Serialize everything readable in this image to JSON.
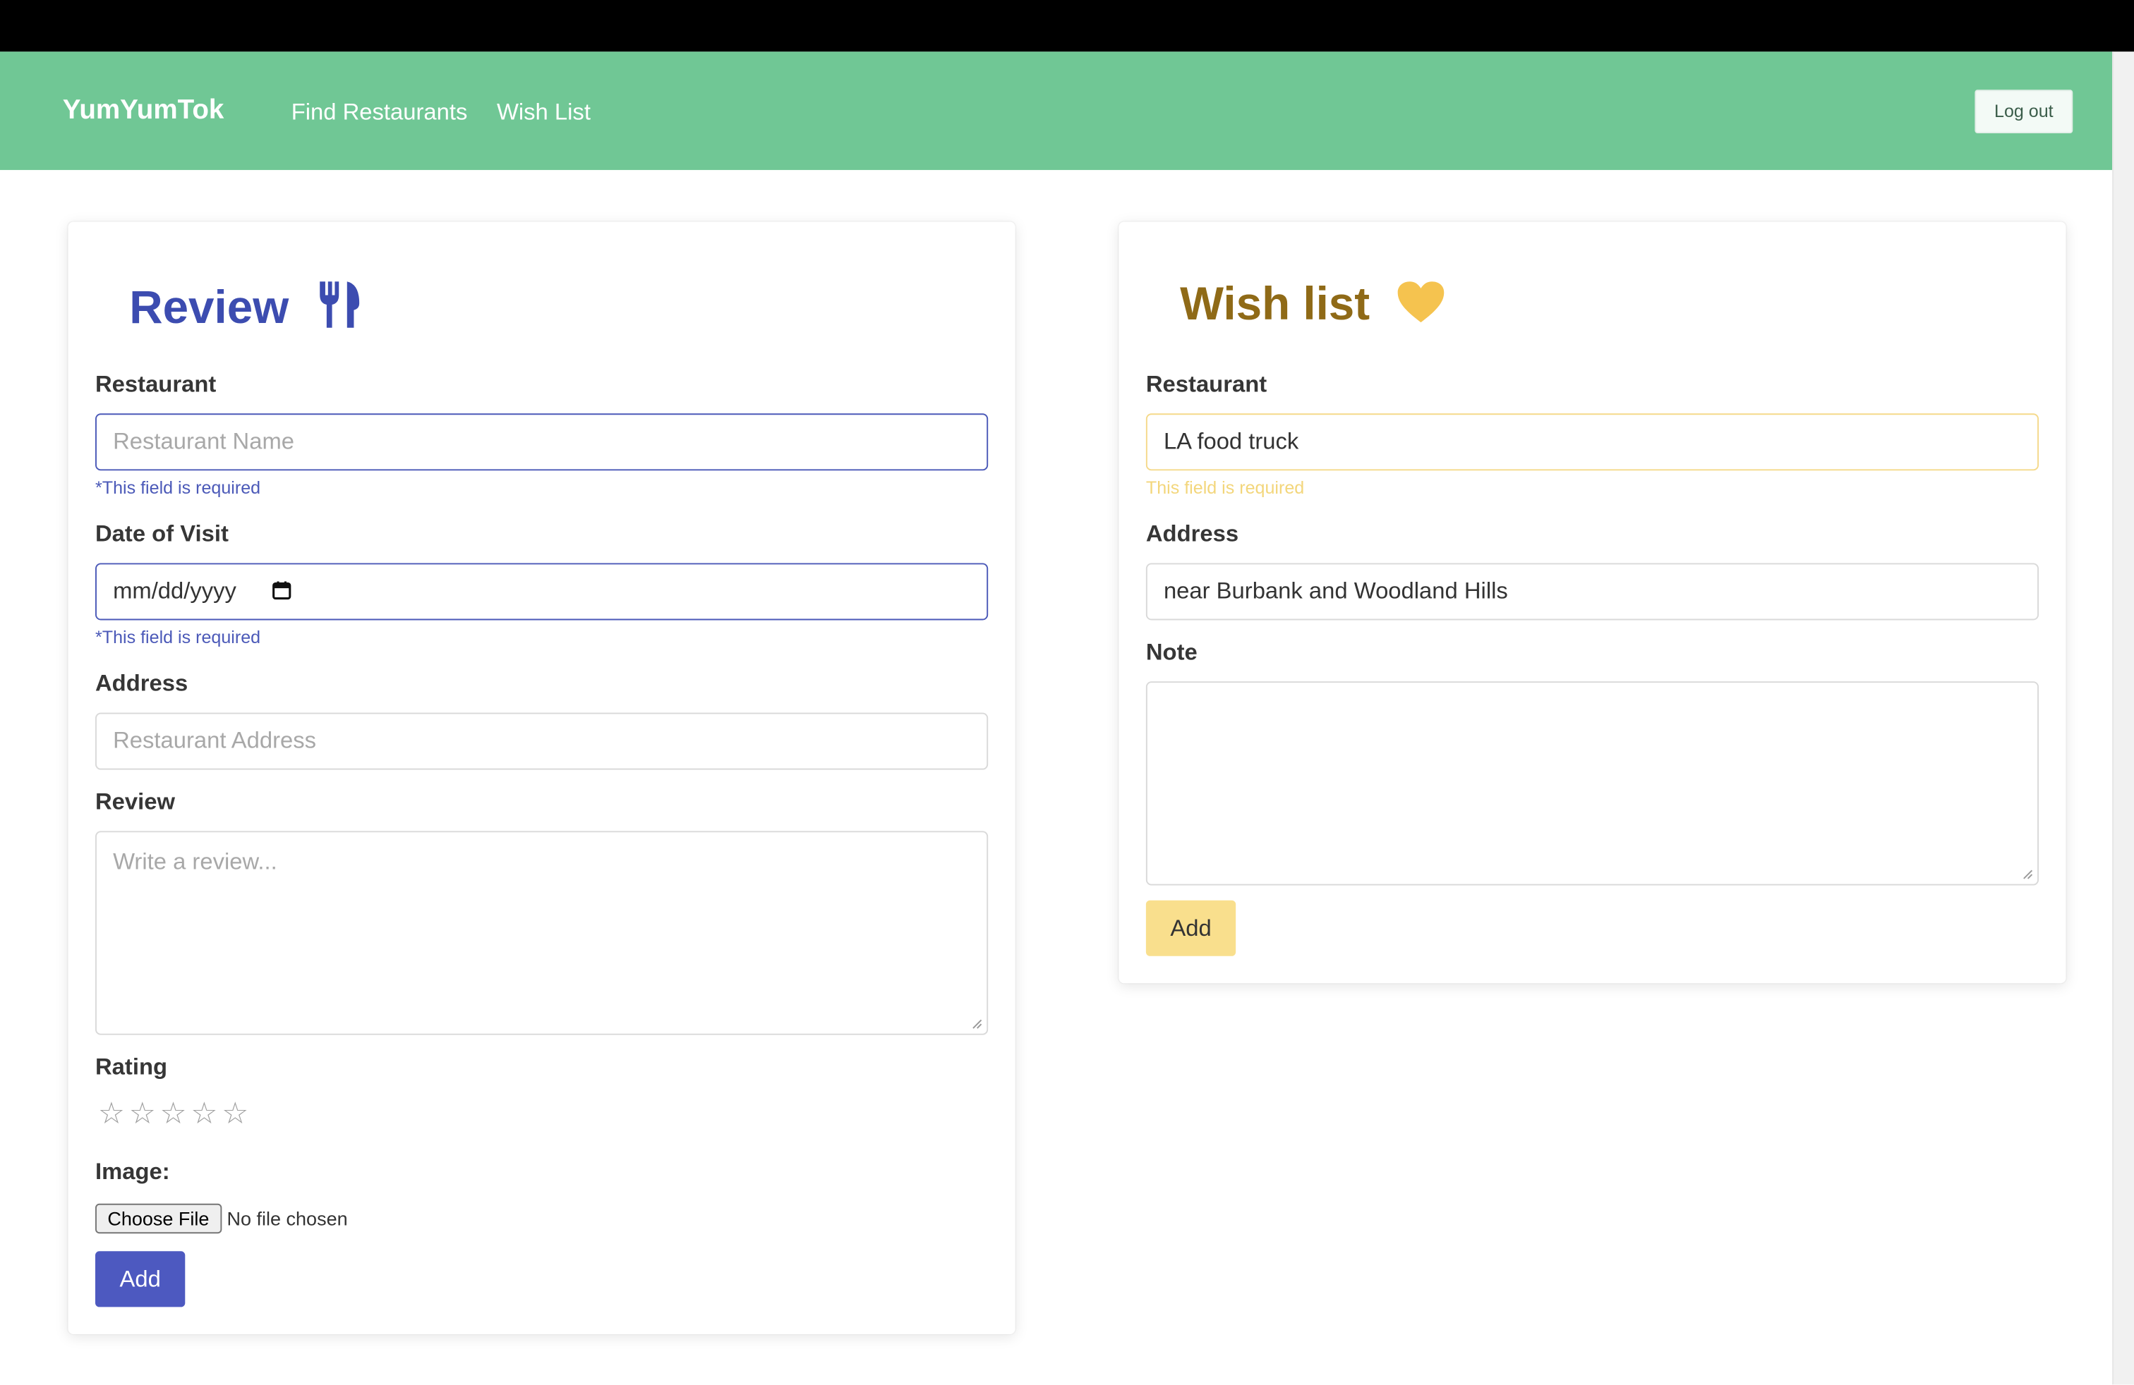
{
  "navbar": {
    "brand": "YumYumTok",
    "links": [
      "Find Restaurants",
      "Wish List"
    ],
    "logout": "Log out",
    "color": "#70c795"
  },
  "review": {
    "title": "Review",
    "icon": "utensils-icon",
    "restaurant_label": "Restaurant",
    "restaurant_placeholder": "Restaurant Name",
    "restaurant_help": "*This field is required",
    "date_label": "Date of Visit",
    "date_value": "mm/dd/yyyy",
    "date_help": "*This field is required",
    "address_label": "Address",
    "address_placeholder": "Restaurant Address",
    "review_label": "Review",
    "review_placeholder": "Write a review...",
    "rating_label": "Rating",
    "rating_value": 0,
    "rating_max": 5,
    "image_label": "Image:",
    "choose_file": "Choose File",
    "no_file": "No file chosen",
    "add": "Add",
    "accent": "#4d59c0"
  },
  "wish": {
    "title": "Wish list",
    "icon": "heart-icon",
    "restaurant_label": "Restaurant",
    "restaurant_value": "LA food truck",
    "restaurant_help": "This field is required",
    "address_label": "Address",
    "address_value": "near Burbank and Woodland Hills",
    "note_label": "Note",
    "note_value": "",
    "add": "Add",
    "accent": "#f9df8d"
  }
}
